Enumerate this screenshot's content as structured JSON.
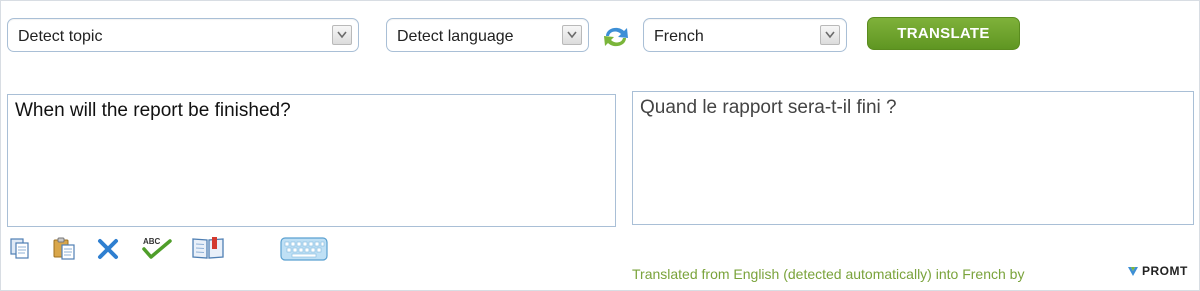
{
  "controls": {
    "topic_select": "Detect topic",
    "source_language_select": "Detect language",
    "target_language_select": "French",
    "translate_button": "TRANSLATE"
  },
  "source": {
    "text": "When will the report be finished?"
  },
  "target": {
    "text": "Quand le rapport sera-t-il fini ?"
  },
  "toolbar": {
    "icons": [
      "copy-icon",
      "paste-icon",
      "clear-icon",
      "spellcheck-icon",
      "dictionary-icon",
      "virtual-keyboard-icon"
    ],
    "spellcheck_glyph": "ABC"
  },
  "footer": {
    "attribution": "Translated from English (detected automatically) into French by",
    "brand": "PROMT"
  },
  "colors": {
    "accent_green": "#6ea52c",
    "select_border": "#a9bfd6",
    "attribution_text": "#7aa33b",
    "clear_icon_blue": "#2f7fd0"
  }
}
